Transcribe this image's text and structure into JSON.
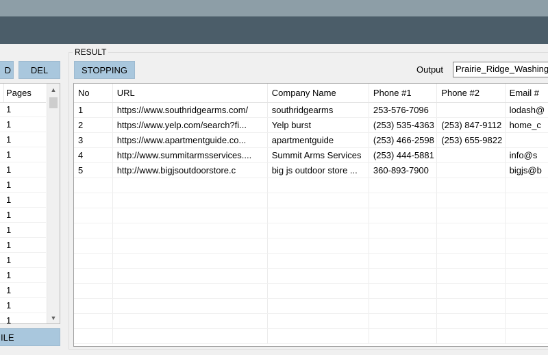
{
  "left_panel": {
    "buttons": {
      "partial_label": "D",
      "del_label": "DEL",
      "bottom_label": "ILE"
    },
    "list_header": "Pages",
    "rows": [
      "1",
      "1",
      "1",
      "1",
      "1",
      "1",
      "1",
      "1",
      "1",
      "1",
      "1",
      "1",
      "1",
      "1",
      "1",
      "1"
    ]
  },
  "result": {
    "legend": "RESULT",
    "stop_button": "STOPPING",
    "output_label": "Output",
    "output_value": "Prairie_Ridge_Washington",
    "columns": [
      "No",
      "URL",
      "Company Name",
      "Phone #1",
      "Phone #2",
      "Email #"
    ],
    "rows": [
      [
        "1",
        "https://www.southridgearms.com/",
        "southridgearms",
        "253-576-7096",
        "",
        "lodash@"
      ],
      [
        "2",
        "https://www.yelp.com/search?fi...",
        "Yelp burst",
        "(253) 535-4363",
        "(253) 847-9112",
        "home_c"
      ],
      [
        "3",
        "https://www.apartmentguide.co...",
        "apartmentguide",
        "(253) 466-2598",
        "(253) 655-9822",
        ""
      ],
      [
        "4",
        "http://www.summitarmsservices....",
        "Summit Arms Services",
        "(253) 444-5881",
        "",
        "info@s"
      ],
      [
        "5",
        "http://www.bigjsoutdoorstore.c",
        "big js outdoor store ...",
        "360-893-7900",
        "",
        "bigjs@b"
      ]
    ],
    "empty_row_count": 11
  },
  "colors": {
    "header": "#4b5d69",
    "top_strip": "#8d9ea7",
    "button": "#a9c7dd"
  },
  "icons": {
    "scroll_up": "chevron-up-icon",
    "scroll_down": "chevron-down-icon"
  }
}
